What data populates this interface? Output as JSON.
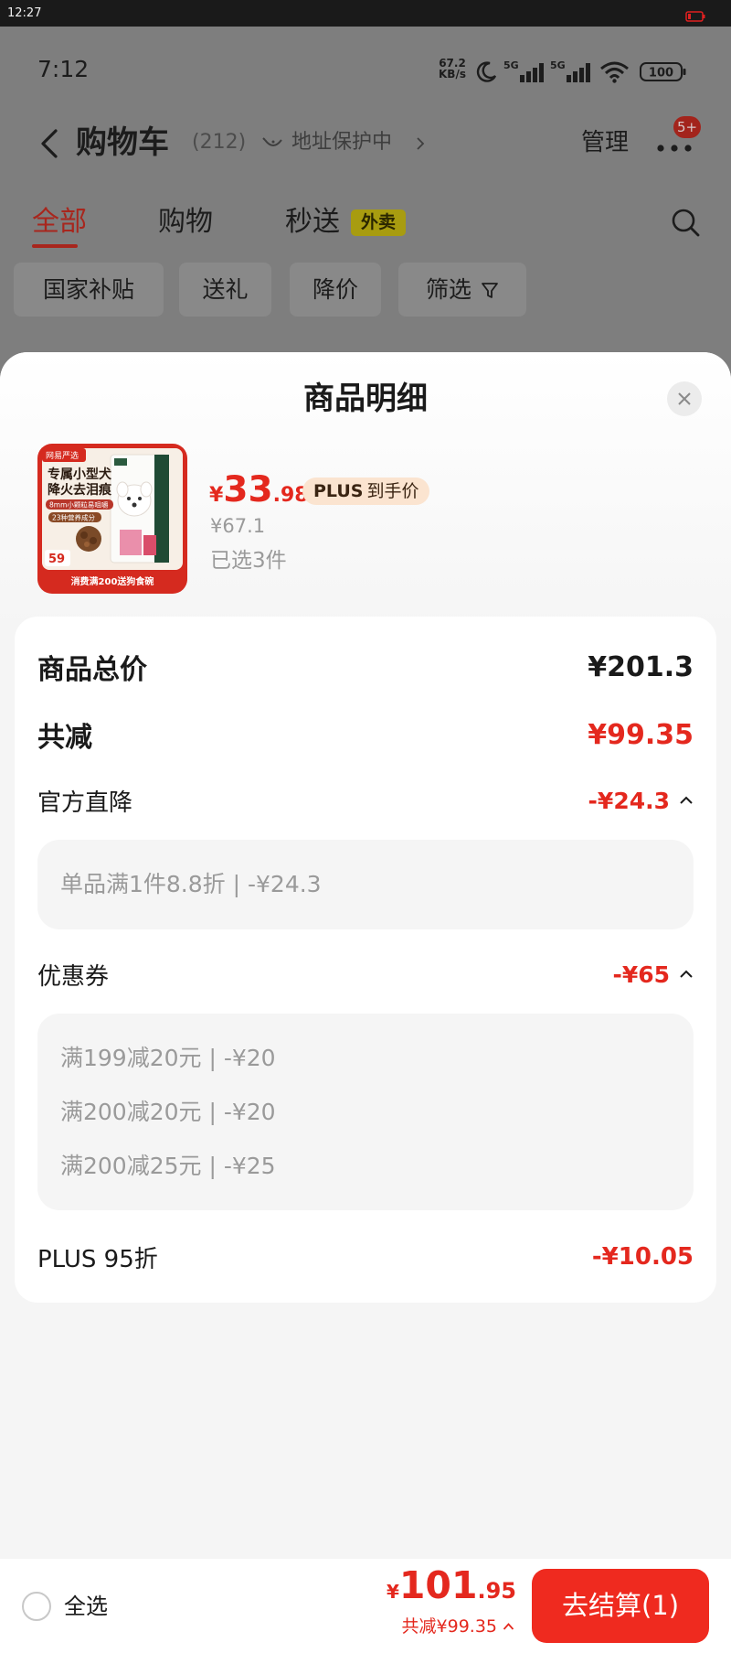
{
  "device_status": {
    "time": "12:27"
  },
  "status_bar": {
    "time": "7:12",
    "net_speed": "67.2",
    "net_unit": "KB/s",
    "sim1": "5G",
    "sim2": "5G",
    "battery": "100"
  },
  "header": {
    "title": "购物车",
    "count": "(212)",
    "address": "地址保护中",
    "manage": "管理",
    "more_badge": "5+"
  },
  "tabs": [
    {
      "label": "全部",
      "active": true
    },
    {
      "label": "购物",
      "active": false
    },
    {
      "label": "秒送",
      "active": false,
      "badge": "外卖"
    }
  ],
  "filters": [
    "国家补贴",
    "送礼",
    "降价",
    "筛选"
  ],
  "sheet": {
    "title": "商品明细",
    "product": {
      "image_text": {
        "brand": "网易严选",
        "headline_1": "专属小型犬",
        "headline_2": "降火去泪痕",
        "feature_1": "8mm小颗粒易咀嚼",
        "feature_2": "23种营养成分",
        "tag_price": "59",
        "banner": "消费满200送狗食碗"
      },
      "currency": "¥",
      "price_int": "33",
      "price_dec": ".98",
      "plus_tag": "PLUS",
      "plus_tag_suffix": "到手价",
      "original_price": "¥67.1",
      "selected_count": "已选3件"
    },
    "breakdown": {
      "total_label": "商品总价",
      "total_value": "¥201.3",
      "discount_label": "共减",
      "discount_value": "¥99.35",
      "groups": [
        {
          "label": "官方直降",
          "value": "-¥24.3",
          "expanded": true,
          "items": [
            "单品满1件8.8折 | -¥24.3"
          ]
        },
        {
          "label": "优惠券",
          "value": "-¥65",
          "expanded": true,
          "items": [
            "满199减20元 | -¥20",
            "满200减20元 | -¥20",
            "满200减25元 | -¥25"
          ]
        }
      ],
      "plus_label": "PLUS 95折",
      "plus_value": "-¥10.05"
    }
  },
  "footer": {
    "select_all": "全选",
    "select_all_checked": false,
    "currency": "¥",
    "total_int": "101",
    "total_dec": ".95",
    "discount": "共减¥99.35",
    "checkout": "去结算(1)"
  },
  "colors": {
    "price_red": "#e4281e",
    "checkout_red": "#ef2a1f",
    "plus_tag_bg": "#fbe4d0",
    "secondary_text": "#9a9a9a",
    "detail_box_bg": "#f5f5f5",
    "backdrop": "#7e7e7e"
  },
  "icons": [
    "back-icon",
    "address-protect-icon",
    "chevron-right-icon",
    "more-icon",
    "search-icon",
    "filter-icon",
    "close-icon",
    "chevron-up-icon",
    "moon-icon",
    "signal-icon",
    "wifi-icon",
    "battery-icon",
    "radio-icon"
  ]
}
